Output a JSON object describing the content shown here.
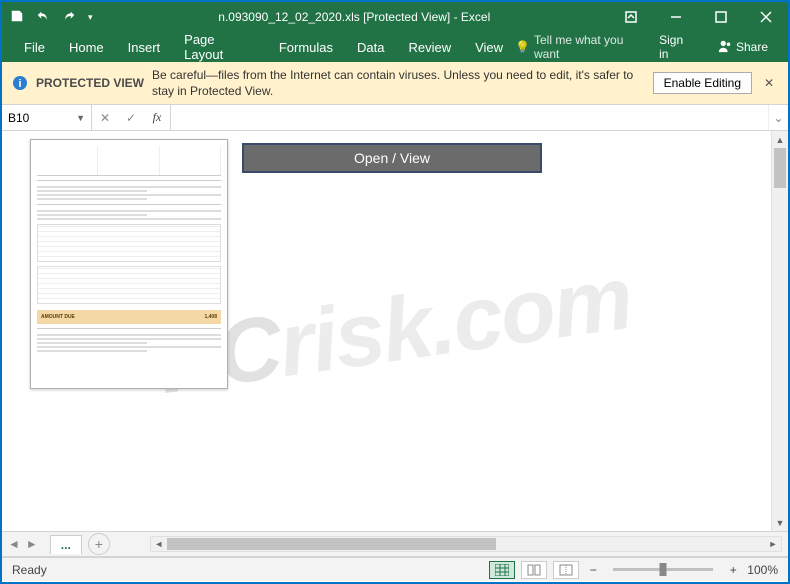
{
  "title": {
    "filename": "n.093090_12_02_2020.xls",
    "suffix": "  [Protected View] - Excel"
  },
  "ribbon": {
    "tabs": [
      "File",
      "Home",
      "Insert",
      "Page Layout",
      "Formulas",
      "Data",
      "Review",
      "View"
    ],
    "tell_me": "Tell me what you want",
    "sign_in": "Sign in",
    "share": "Share"
  },
  "protected_view": {
    "label": "PROTECTED VIEW",
    "message": "Be careful—files from the Internet can contain viruses. Unless you need to edit, it's safer to stay in Protected View.",
    "enable": "Enable Editing"
  },
  "formula": {
    "cell_ref": "B10",
    "fx": "fx",
    "value": ""
  },
  "sheet": {
    "open_button": "Open / View",
    "thumb": {
      "amount_label": "AMOUNT DUE",
      "amount_value": "1,408"
    },
    "active_tab": "...",
    "add_tab": "+"
  },
  "status": {
    "ready": "Ready",
    "zoom": "100%",
    "minus": "−",
    "plus": "+"
  },
  "watermark": {
    "pc": "PC",
    "rest": "risk.com"
  },
  "icons": {
    "save": "save-icon",
    "undo": "undo-icon",
    "redo": "redo-icon",
    "restore": "restore-down-icon",
    "minimize": "minimize-icon",
    "maximize": "maximize-icon",
    "close": "close-icon",
    "bulb": "lightbulb-icon",
    "share": "share-people-icon",
    "info": "info-shield-icon"
  }
}
